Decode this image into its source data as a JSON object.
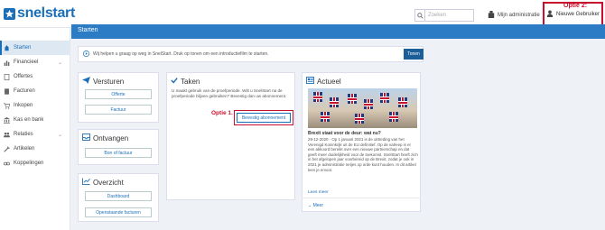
{
  "app": {
    "logo": "snelstart"
  },
  "topbar": {
    "search_placeholder": "Zoeken",
    "admin_label": "Mijn administratie",
    "user_label": "Nieuwe Gebruiker",
    "annotation_optie2": "Optie 2:"
  },
  "sidebar": {
    "items": [
      {
        "label": "Starten",
        "icon": "rocket-icon",
        "active": true
      },
      {
        "label": "Financieel",
        "icon": "chart-icon",
        "chevron": true
      },
      {
        "label": "Offertes",
        "icon": "document-icon"
      },
      {
        "label": "Facturen",
        "icon": "invoice-icon"
      },
      {
        "label": "Inkopen",
        "icon": "cart-icon"
      },
      {
        "label": "Kas en bank",
        "icon": "bank-icon"
      },
      {
        "label": "Relaties",
        "icon": "people-icon",
        "chevron": true
      },
      {
        "label": "Artikelen",
        "icon": "tools-icon"
      },
      {
        "label": "Koppelingen",
        "icon": "link-icon"
      }
    ]
  },
  "header": {
    "title": "Starten"
  },
  "banner": {
    "text": "Wij helpen u graag op weg in SnelStart. Druk op tonen om een introductiefilm te starten.",
    "button": "Tonen"
  },
  "versturen": {
    "title": "Versturen",
    "offerte": "Offerte",
    "factuur": "Factuur"
  },
  "ontvangen": {
    "title": "Ontvangen",
    "bon": "Bon of factuur"
  },
  "overzicht": {
    "title": "Overzicht",
    "dashboard": "Dashboard",
    "openstaande": "Openstaande facturen"
  },
  "taken": {
    "title": "Taken",
    "text": "U maakt gebruik van de proefperiode. Wilt u SnelStart na de proefperiode blijven gebruiken? Bevestig dan uw abonnement.",
    "button": "Bevestig abonnement",
    "annotation_optie1": "Optie 1."
  },
  "actueel": {
    "title": "Actueel",
    "news_title": "Brexit staat voor de deur: wat nu?",
    "news_text": "29-12-2020 · Op 1 januari 2021 is de uittreding van het Verenigd Koninkrijk uit de EU definitief. Op de valreep is er een akkoord bereikt over een nieuwe partnerschap en dat geeft meer duidelijkheid voor de toekomst. SnelStart heeft zich in het afgelopen jaar voorbereid op de Brexit, zodat je ook in 2021 je administratie netjes op orde kunt houden. In dit artikel lees je ervoor.",
    "lees_meer": "Lees meer",
    "meer": "Meer"
  },
  "colors": {
    "brand": "#1b6fb8",
    "header": "#2b7bc5",
    "annotation": "#c8102e"
  }
}
